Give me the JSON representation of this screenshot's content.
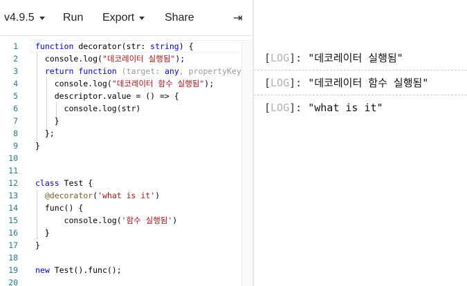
{
  "toolbar": {
    "version_label": "v4.9.5",
    "run_label": "Run",
    "export_label": "Export",
    "share_label": "Share",
    "sidebar_toggle_icon": "⇥"
  },
  "editor": {
    "line_numbers": [
      "1",
      "2",
      "3",
      "4",
      "5",
      "6",
      "7",
      "8",
      "9",
      "10",
      "11",
      "12",
      "13",
      "14",
      "15",
      "16",
      "17",
      "18",
      "19",
      "20"
    ],
    "lines": [
      [
        {
          "t": "function",
          "c": "kw"
        },
        {
          "t": " decorator(str: ",
          "c": "plain"
        },
        {
          "t": "string",
          "c": "type"
        },
        {
          "t": ") {",
          "c": "plain"
        }
      ],
      [
        {
          "t": "  console.log(",
          "c": "plain"
        },
        {
          "t": "\"데코레이터 실행됨\"",
          "c": "str"
        },
        {
          "t": ");",
          "c": "plain"
        }
      ],
      [
        {
          "t": "  ",
          "c": "plain"
        },
        {
          "t": "return",
          "c": "kw"
        },
        {
          "t": " ",
          "c": "plain"
        },
        {
          "t": "function",
          "c": "kw"
        },
        {
          "t": " (target: ",
          "c": "faded"
        },
        {
          "t": "any",
          "c": "kw"
        },
        {
          "t": ", propertyKey:",
          "c": "faded"
        }
      ],
      [
        {
          "t": "    console.log(",
          "c": "plain"
        },
        {
          "t": "\"데코레이터 함수 실행됨\"",
          "c": "str"
        },
        {
          "t": ");",
          "c": "plain"
        }
      ],
      [
        {
          "t": "    descriptor.value = () => {",
          "c": "plain"
        }
      ],
      [
        {
          "t": "      console.log(str)",
          "c": "plain"
        }
      ],
      [
        {
          "t": "    }",
          "c": "plain"
        }
      ],
      [
        {
          "t": "  };",
          "c": "plain"
        }
      ],
      [
        {
          "t": "}",
          "c": "plain"
        }
      ],
      [],
      [],
      [
        {
          "t": "class",
          "c": "kw"
        },
        {
          "t": " Test {",
          "c": "plain"
        }
      ],
      [
        {
          "t": "  ",
          "c": "plain"
        },
        {
          "t": "@decorator",
          "c": "dec"
        },
        {
          "t": "(",
          "c": "plain"
        },
        {
          "t": "'what is it'",
          "c": "str"
        },
        {
          "t": ")",
          "c": "plain"
        }
      ],
      [
        {
          "t": "  func() {",
          "c": "plain"
        }
      ],
      [
        {
          "t": "      console.log(",
          "c": "plain"
        },
        {
          "t": "'함수 실행됨'",
          "c": "str"
        },
        {
          "t": ")",
          "c": "plain"
        }
      ],
      [
        {
          "t": "  }",
          "c": "plain"
        }
      ],
      [
        {
          "t": "}",
          "c": "plain"
        }
      ],
      [],
      [
        {
          "t": "new",
          "c": "kw"
        },
        {
          "t": " Test().func();",
          "c": "plain"
        }
      ],
      []
    ]
  },
  "logs": [
    {
      "tag": "LOG",
      "message": "\"데코레이터 실행됨\""
    },
    {
      "tag": "LOG",
      "message": "\"데코레이터 함수 실행됨\""
    },
    {
      "tag": "LOG",
      "message": "\"what is it\""
    }
  ],
  "colors": {
    "keyword": "#0000ff",
    "string": "#a31515",
    "decorator": "#795e26",
    "line_number": "#237893",
    "log_tag": "#b0b0b0"
  }
}
